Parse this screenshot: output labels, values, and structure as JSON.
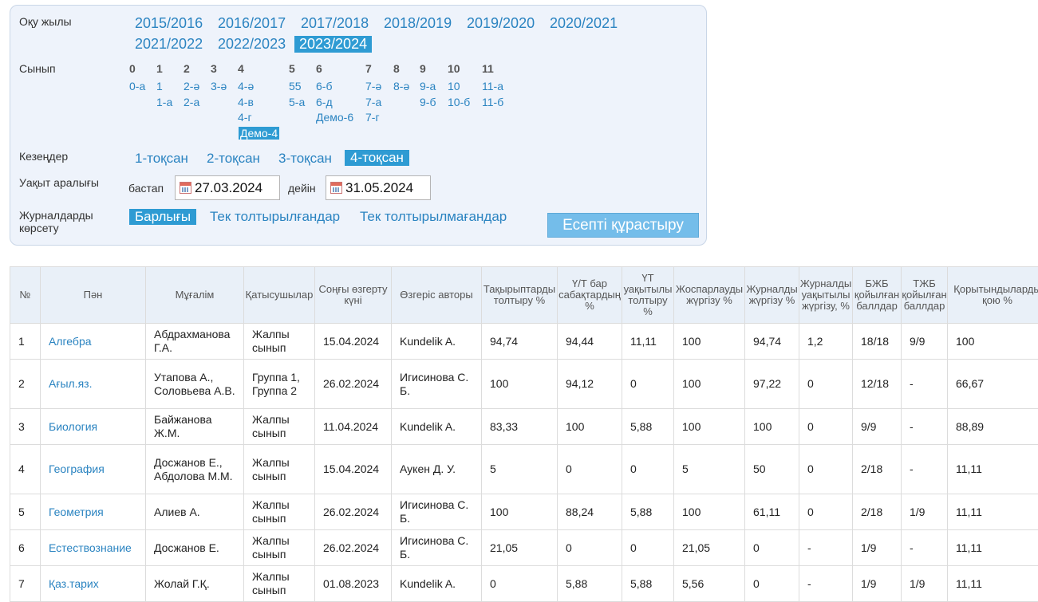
{
  "filters": {
    "year_label": "Оқу жылы",
    "years": [
      "2015/2016",
      "2016/2017",
      "2017/2018",
      "2018/2019",
      "2019/2020",
      "2020/2021",
      "2021/2022",
      "2022/2023",
      "2023/2024"
    ],
    "selected_year": "2023/2024",
    "class_label": "Сынып",
    "grades": [
      {
        "num": "0",
        "classes": [
          "0-а"
        ]
      },
      {
        "num": "1",
        "classes": [
          "1",
          "1-а"
        ]
      },
      {
        "num": "2",
        "classes": [
          "2-ә",
          "2-а"
        ]
      },
      {
        "num": "3",
        "classes": [
          "3-ә"
        ]
      },
      {
        "num": "4",
        "classes": [
          "4-ә",
          "4-в",
          "4-г",
          "Демо-4"
        ]
      },
      {
        "num": "5",
        "classes": [
          "55",
          "5-а"
        ]
      },
      {
        "num": "6",
        "classes": [
          "6-б",
          "6-д",
          "Демо-6"
        ]
      },
      {
        "num": "7",
        "classes": [
          "7-ә",
          "7-а",
          "7-г"
        ]
      },
      {
        "num": "8",
        "classes": [
          "8-ә"
        ]
      },
      {
        "num": "9",
        "classes": [
          "9-а",
          "9-б"
        ]
      },
      {
        "num": "10",
        "classes": [
          "10",
          "10-б"
        ]
      },
      {
        "num": "11",
        "classes": [
          "11-а",
          "11-б"
        ]
      }
    ],
    "selected_class": "Демо-4",
    "period_label": "Кезеңдер",
    "periods": [
      "1-тоқсан",
      "2-тоқсан",
      "3-тоқсан",
      "4-тоқсан"
    ],
    "selected_period": "4-тоқсан",
    "time_label": "Уақыт аралығы",
    "from_label": "бастап",
    "from_date": "27.03.2024",
    "to_label": "дейін",
    "to_date": "31.05.2024",
    "show_label": "Журналдарды көрсету",
    "show_options": [
      "Барлығы",
      "Тек толтырылғандар",
      "Тек толтырылмағандар"
    ],
    "selected_show": "Барлығы",
    "build_button": "Есепті құрастыру"
  },
  "table": {
    "headers": [
      "№",
      "Пән",
      "Мұғалім",
      "Қатысушылар",
      "Соңғы өзгерту күні",
      "Өзгеріс авторы",
      "Тақырыптарды толтыру %",
      "Ү/Т бар сабақтардың %",
      "ҮТ уақытылы толтыру %",
      "Жоспарлауды жүргізу %",
      "Журналды жүргізу %",
      "Журналды уақытылы жүргізу, %",
      "БЖБ қойылған баллдар",
      "ТЖБ қойылған баллдар",
      "Қорытындыларды қою %"
    ],
    "rows": [
      [
        "1",
        "Алгебра",
        "Абдрахманова Г.А.",
        "Жалпы сынып",
        "15.04.2024",
        "Kundelik A.",
        "94,74",
        "94,44",
        "11,11",
        "100",
        "94,74",
        "1,2",
        "18/18",
        "9/9",
        "100"
      ],
      [
        "2",
        "Ағыл.яз.",
        "Утапова А., Соловьева А.В.",
        "Группа 1, Группа 2",
        "26.02.2024",
        "Игисинова С. Б.",
        "100",
        "94,12",
        "0",
        "100",
        "97,22",
        "0",
        "12/18",
        "-",
        "66,67"
      ],
      [
        "3",
        "Биология",
        "Байжанова Ж.М.",
        "Жалпы сынып",
        "11.04.2024",
        "Kundelik A.",
        "83,33",
        "100",
        "5,88",
        "100",
        "100",
        "0",
        "9/9",
        "-",
        "88,89"
      ],
      [
        "4",
        "География",
        "Досжанов Е., Абдолова М.М.",
        "Жалпы сынып",
        "15.04.2024",
        "Аукен Д. У.",
        "5",
        "0",
        "0",
        "5",
        "50",
        "0",
        "2/18",
        "-",
        "11,11"
      ],
      [
        "5",
        "Геометрия",
        "Алиев А.",
        "Жалпы сынып",
        "26.02.2024",
        "Игисинова С. Б.",
        "100",
        "88,24",
        "5,88",
        "100",
        "61,11",
        "0",
        "2/18",
        "1/9",
        "11,11"
      ],
      [
        "6",
        "Естествознание",
        "Досжанов Е.",
        "Жалпы сынып",
        "26.02.2024",
        "Игисинова С. Б.",
        "21,05",
        "0",
        "0",
        "21,05",
        "0",
        "-",
        "1/9",
        "-",
        "11,11"
      ],
      [
        "7",
        "Қаз.тарих",
        "Жолай Г.Қ.",
        "Жалпы сынып",
        "01.08.2023",
        "Kundelik A.",
        "0",
        "5,88",
        "5,88",
        "5,56",
        "0",
        "-",
        "1/9",
        "1/9",
        "11,11"
      ]
    ]
  }
}
